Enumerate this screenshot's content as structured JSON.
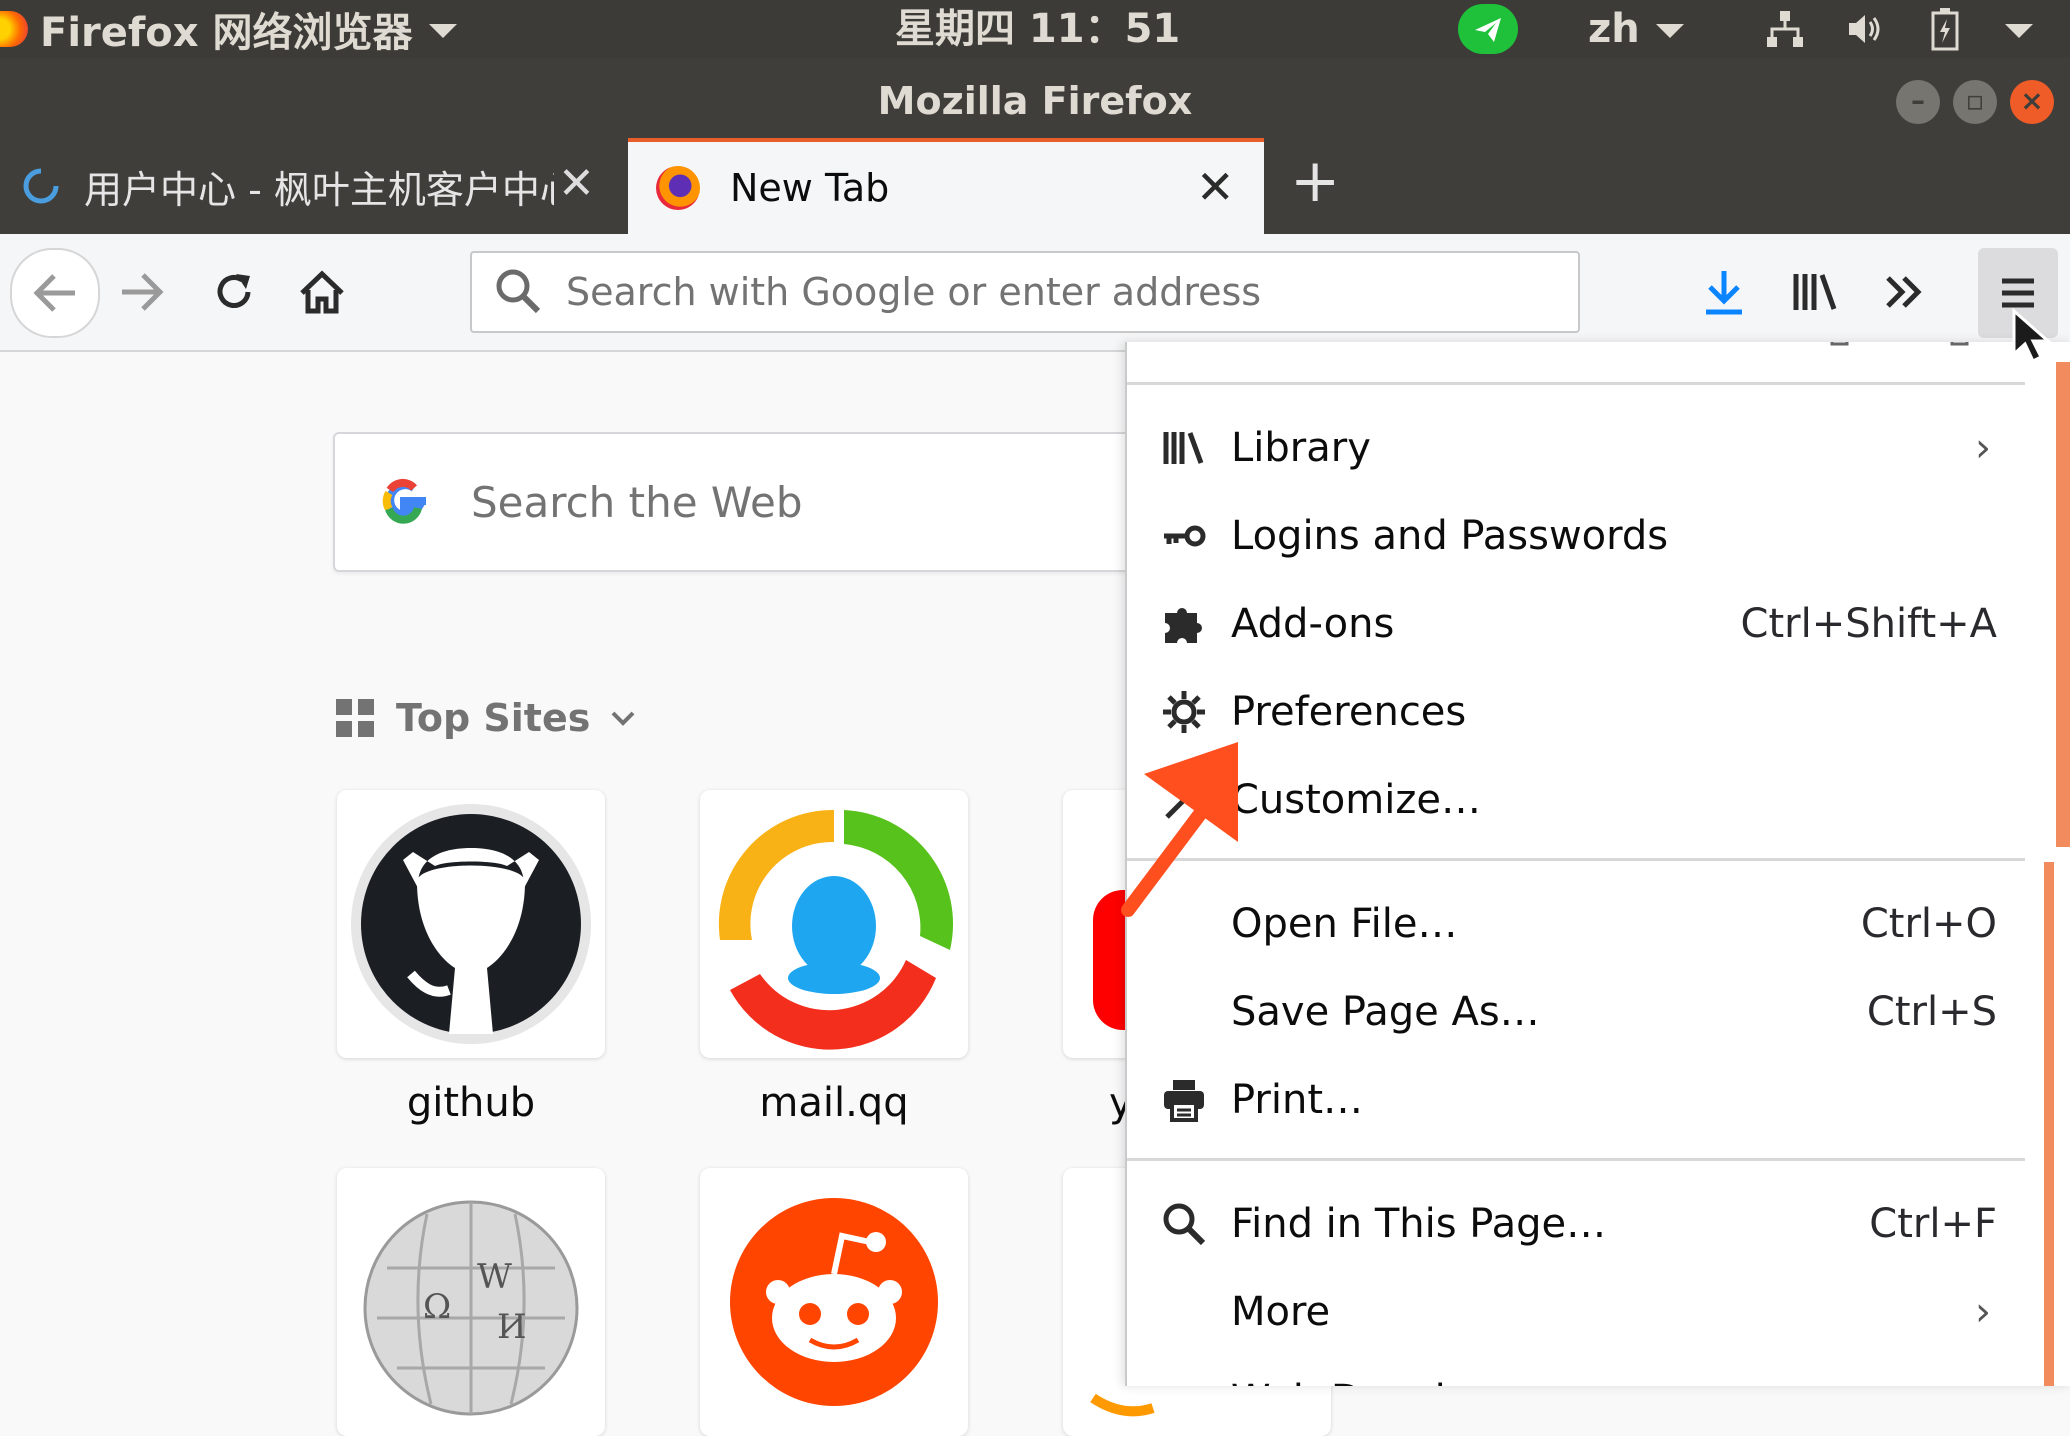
{
  "os_panel": {
    "app_menu_label": "Firefox 网络浏览器",
    "clock": "星期四 11：51",
    "language": "zh"
  },
  "window": {
    "title": "Mozilla Firefox"
  },
  "tabs": [
    {
      "label": "用户中心 - 枫叶主机客户中心",
      "active": false
    },
    {
      "label": "New Tab",
      "active": true
    }
  ],
  "url_bar": {
    "placeholder": "Search with Google or enter address",
    "value": ""
  },
  "page": {
    "search_placeholder": "Search the Web",
    "top_sites_label": "Top Sites",
    "top_sites": [
      {
        "label": "github",
        "icon": "github-icon"
      },
      {
        "label": "mail.qq",
        "icon": "qq-icon"
      },
      {
        "label": "y",
        "icon": "youtube-icon"
      },
      {
        "label": "",
        "icon": "wikipedia-icon"
      },
      {
        "label": "",
        "icon": "reddit-icon"
      },
      {
        "label": "",
        "icon": "amazon-icon"
      }
    ]
  },
  "app_menu": {
    "items": [
      {
        "label": "Library",
        "shortcut": "",
        "submenu": true,
        "icon": "library-icon"
      },
      {
        "label": "Logins and Passwords",
        "shortcut": "",
        "submenu": false,
        "icon": "key-icon"
      },
      {
        "label": "Add-ons",
        "shortcut": "Ctrl+Shift+A",
        "submenu": false,
        "icon": "puzzle-icon"
      },
      {
        "label": "Preferences",
        "shortcut": "",
        "submenu": false,
        "icon": "gear-icon"
      },
      {
        "label": "Customize…",
        "shortcut": "",
        "submenu": false,
        "icon": "brush-icon"
      },
      {
        "label": "Open File…",
        "shortcut": "Ctrl+O",
        "submenu": false,
        "icon": ""
      },
      {
        "label": "Save Page As…",
        "shortcut": "Ctrl+S",
        "submenu": false,
        "icon": ""
      },
      {
        "label": "Print…",
        "shortcut": "",
        "submenu": false,
        "icon": "printer-icon"
      },
      {
        "label": "Find in This Page…",
        "shortcut": "Ctrl+F",
        "submenu": false,
        "icon": "search-icon"
      },
      {
        "label": "More",
        "shortcut": "",
        "submenu": true,
        "icon": ""
      },
      {
        "label": "Web Developer",
        "shortcut": "",
        "submenu": true,
        "icon": ""
      }
    ]
  },
  "colors": {
    "accent": "#e85d2a",
    "annotation_arrow": "#ff4f1f",
    "download_blue": "#0a84ff"
  }
}
